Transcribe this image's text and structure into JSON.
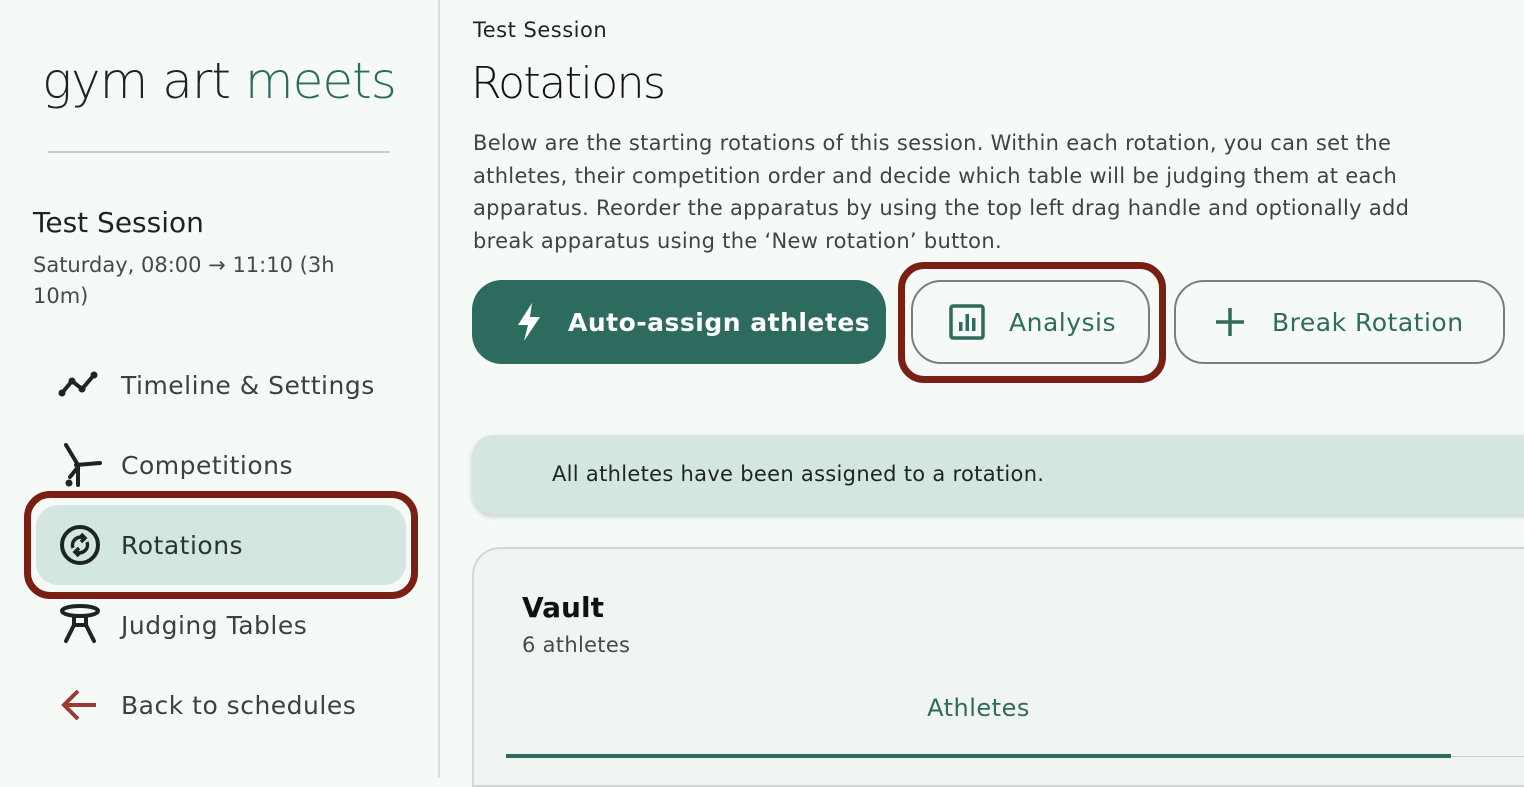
{
  "app": {
    "logo_part1": "gym art ",
    "logo_part2": "meets",
    "brand_color": "#2e6b5f",
    "highlight_color": "#7a1f14"
  },
  "sidebar": {
    "session_name": "Test Session",
    "session_time": "Saturday, 08:00 → 11:10 (3h 10m)",
    "items": [
      {
        "label": "Timeline & Settings",
        "icon": "timeline-icon"
      },
      {
        "label": "Competitions",
        "icon": "gymnast-icon"
      },
      {
        "label": "Rotations",
        "icon": "rotate-icon",
        "active": true
      },
      {
        "label": "Judging Tables",
        "icon": "table-icon"
      },
      {
        "label": "Back to schedules",
        "icon": "arrow-left-icon"
      }
    ]
  },
  "main": {
    "breadcrumb": "Test Session",
    "title": "Rotations",
    "description": "Below are the starting rotations of this session. Within each rotation, you can set the athletes, their competition order and decide which table will be judging them at each apparatus. Reorder the apparatus by using the top left drag handle and optionally add break apparatus using the ‘New rotation’ button.",
    "buttons": {
      "auto_assign": "Auto-assign athletes",
      "analysis": "Analysis",
      "break_rotation": "Break Rotation"
    },
    "banner": "All athletes have been assigned to a rotation.",
    "rotation_card": {
      "title": "Vault",
      "subtitle": "6 athletes",
      "tab": "Athletes"
    }
  }
}
